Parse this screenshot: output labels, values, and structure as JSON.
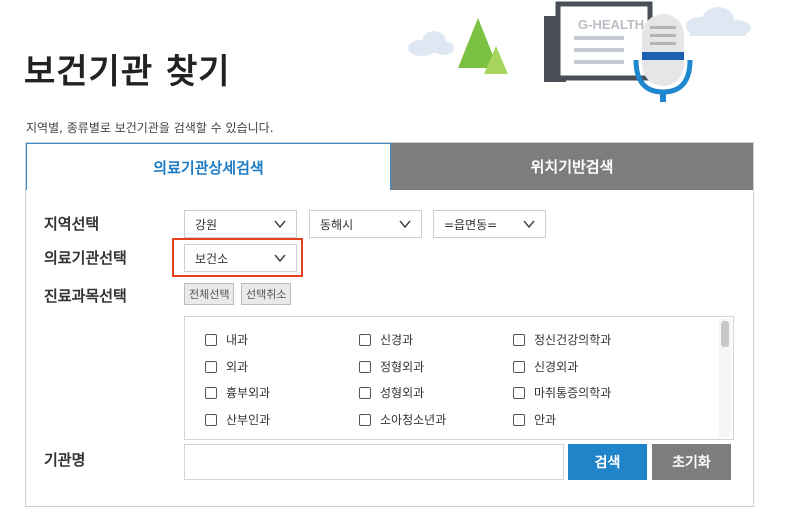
{
  "header": {
    "title": "보건기관 찾기",
    "subtitle": "지역별, 종류별로 보건기관을 검색할 수 있습니다.",
    "banner_text": "G-HEALTH"
  },
  "tabs": [
    {
      "label": "의료기관상세검색",
      "active": true
    },
    {
      "label": "위치기반검색",
      "active": false
    }
  ],
  "form": {
    "region_label": "지역선택",
    "region_selects": [
      "강원",
      "동해시",
      "=읍면동="
    ],
    "institution_label": "의료기관선택",
    "institution_select": "보건소",
    "department_label": "진료과목선택",
    "select_all": "전체선택",
    "deselect_all": "선택취소",
    "departments": [
      "내과",
      "신경과",
      "정신건강의학과",
      "외과",
      "정형외과",
      "신경외과",
      "흉부외과",
      "성형외과",
      "마취통증의학과",
      "산부인과",
      "소아청소년과",
      "안과"
    ],
    "name_label": "기관명",
    "name_value": "",
    "search_button": "검색",
    "reset_button": "초기화"
  },
  "colors": {
    "accent": "#1f85c8",
    "tab_inactive": "#7d7d7d",
    "highlight": "#e8401c"
  }
}
